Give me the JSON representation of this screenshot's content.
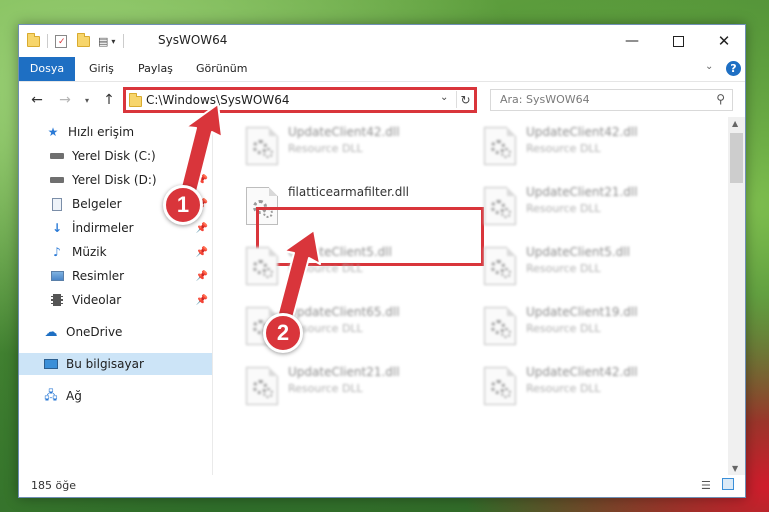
{
  "window": {
    "title": "SysWOW64",
    "controls": [
      "minimize-icon",
      "maximize-icon",
      "close-icon"
    ]
  },
  "ribbon": {
    "tabs": [
      "Dosya",
      "Giriş",
      "Paylaş",
      "Görünüm"
    ],
    "file_tab_color": "#1e6fc3"
  },
  "nav": {
    "address": "C:\\Windows\\SysWOW64",
    "search_placeholder": "Ara: SysWOW64"
  },
  "sidebar": {
    "items": [
      {
        "label": "Hızlı erişim",
        "icon": "star-icon",
        "pinned": false
      },
      {
        "label": "Yerel Disk (C:)",
        "icon": "drive-icon",
        "pinned": true
      },
      {
        "label": "Yerel Disk (D:)",
        "icon": "drive-icon",
        "pinned": true
      },
      {
        "label": "Belgeler",
        "icon": "document-icon",
        "pinned": true
      },
      {
        "label": "İndirmeler",
        "icon": "download-icon",
        "pinned": true
      },
      {
        "label": "Müzik",
        "icon": "music-icon",
        "pinned": true
      },
      {
        "label": "Resimler",
        "icon": "pictures-icon",
        "pinned": true
      },
      {
        "label": "Videolar",
        "icon": "video-icon",
        "pinned": true
      },
      {
        "label": "OneDrive",
        "icon": "cloud-icon",
        "pinned": false
      },
      {
        "label": "Bu bilgisayar",
        "icon": "computer-icon",
        "pinned": false,
        "selected": true
      },
      {
        "label": "Ağ",
        "icon": "network-icon",
        "pinned": false
      }
    ]
  },
  "files": [
    {
      "name": "UpdateClient42.dll",
      "desc": "Resource DLL"
    },
    {
      "name": "UpdateClient42.dll",
      "desc": "Resource DLL"
    },
    {
      "name": "filatticearmafilter.dll",
      "desc": ""
    },
    {
      "name": "UpdateClient21.dll",
      "desc": "Resource DLL"
    },
    {
      "name": "UpdateClient5.dll",
      "desc": "Resource DLL"
    },
    {
      "name": "UpdateClient5.dll",
      "desc": "Resource DLL"
    },
    {
      "name": "UpdateClient65.dll",
      "desc": "Resource DLL"
    },
    {
      "name": "UpdateClient19.dll",
      "desc": "Resource DLL"
    },
    {
      "name": "UpdateClient21.dll",
      "desc": "Resource DLL"
    },
    {
      "name": "UpdateClient42.dll",
      "desc": "Resource DLL"
    }
  ],
  "status": {
    "count": "185 öğe"
  },
  "callouts": [
    "1",
    "2"
  ],
  "colors": {
    "highlight": "#d9353b",
    "selection": "#cce4f7"
  }
}
